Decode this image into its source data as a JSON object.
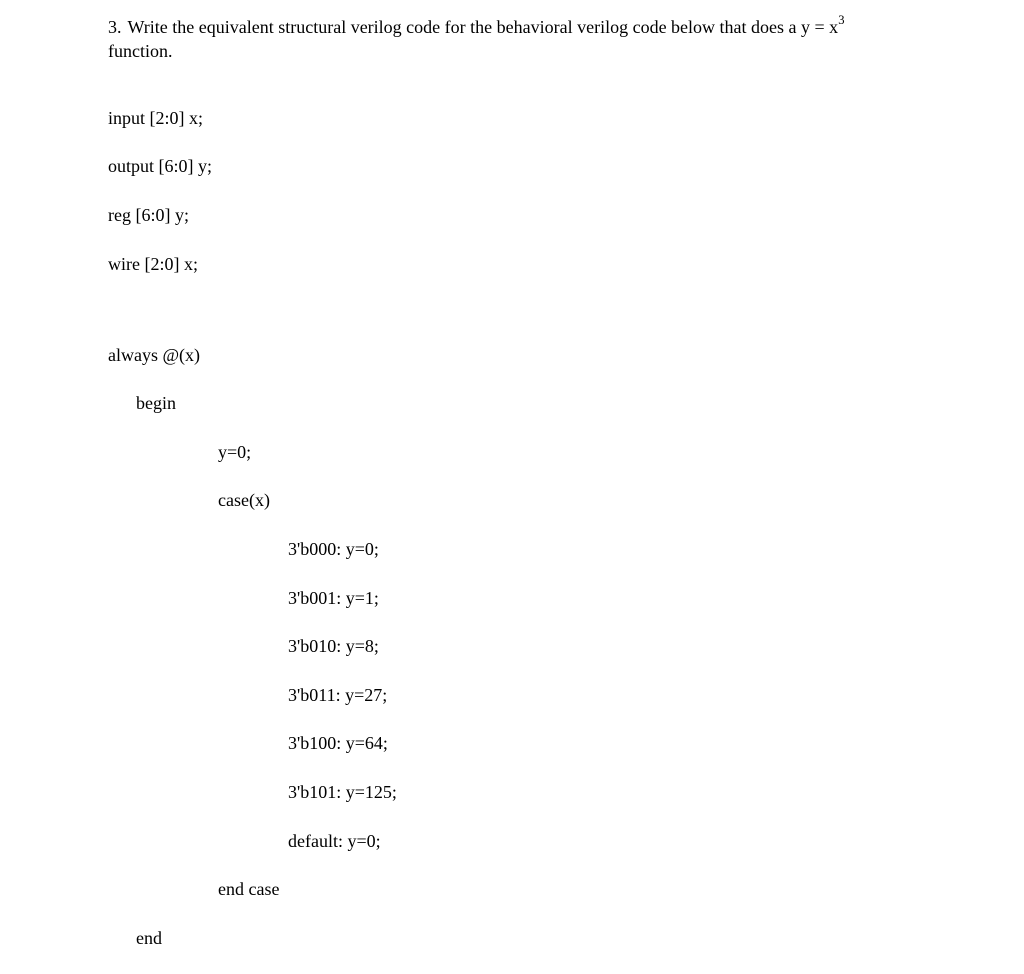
{
  "question": {
    "number": "3.",
    "text_prefix": "Write the equivalent structural verilog code for the behavioral verilog code below that does a y = x",
    "exponent": "3",
    "text_suffix": "function."
  },
  "decl": {
    "l1": "input [2:0] x;",
    "l2": "output [6:0] y;",
    "l3": "reg [6:0] y;",
    "l4": "wire [2:0] x;"
  },
  "always": {
    "head": "always @(x)",
    "begin": "begin",
    "stmt1": "y=0;",
    "casehead": "case(x)",
    "c0": "3'b000: y=0;",
    "c1": "3'b001: y=1;",
    "c2": "3'b010: y=8;",
    "c3": "3'b011: y=27;",
    "c4": "3'b100: y=64;",
    "c5": "3'b101: y=125;",
    "cdef": "default: y=0;",
    "endcase": "end case",
    "end": "end"
  }
}
